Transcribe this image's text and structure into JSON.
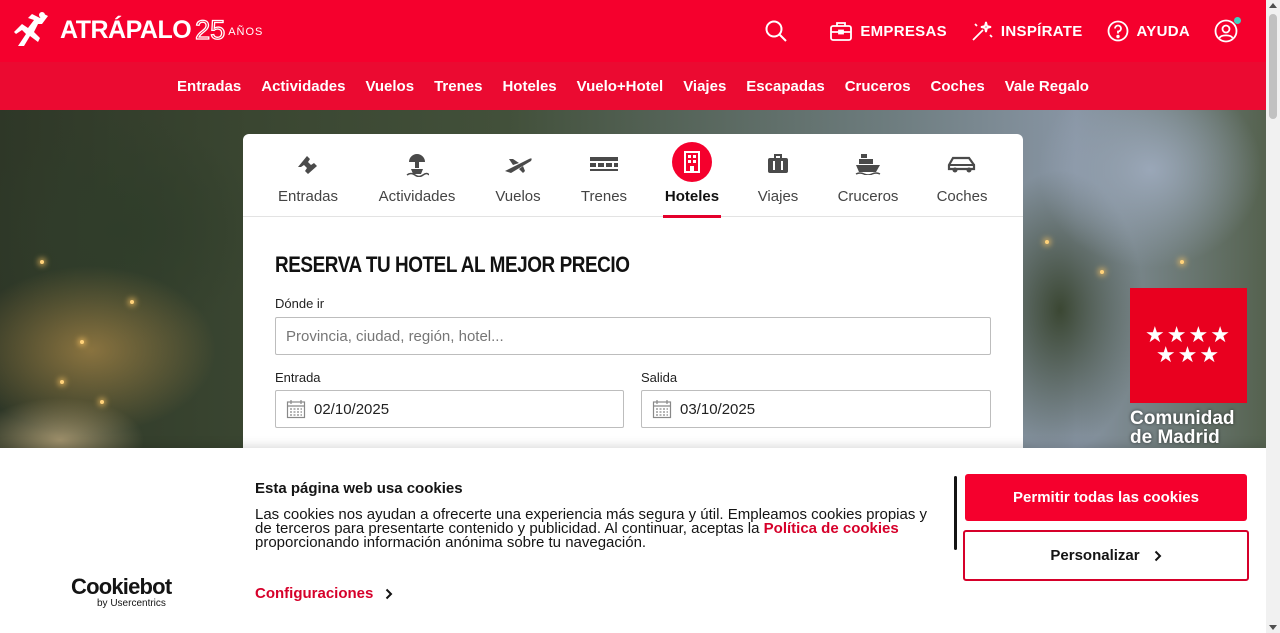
{
  "brand": {
    "name": "ATRÁPALO",
    "anniversary_number": "25",
    "anniversary_word": "AÑOS",
    "primary_color": "#f5002d",
    "nav_color": "#eb0a31"
  },
  "header": {
    "actions": [
      {
        "label": "EMPRESAS",
        "icon": "briefcase-icon"
      },
      {
        "label": "INSPÍRATE",
        "icon": "sparkle-icon"
      },
      {
        "label": "AYUDA",
        "icon": "help-icon"
      }
    ]
  },
  "nav": {
    "items": [
      "Entradas",
      "Actividades",
      "Vuelos",
      "Trenes",
      "Hoteles",
      "Vuelo+Hotel",
      "Viajes",
      "Escapadas",
      "Cruceros",
      "Coches",
      "Vale Regalo"
    ]
  },
  "search_card": {
    "tabs": [
      {
        "label": "Entradas",
        "icon": "ticket-icon",
        "active": false
      },
      {
        "label": "Actividades",
        "icon": "activity-icon",
        "active": false
      },
      {
        "label": "Vuelos",
        "icon": "plane-icon",
        "active": false
      },
      {
        "label": "Trenes",
        "icon": "train-icon",
        "active": false
      },
      {
        "label": "Hoteles",
        "icon": "hotel-icon",
        "active": true
      },
      {
        "label": "Viajes",
        "icon": "luggage-icon",
        "active": false
      },
      {
        "label": "Cruceros",
        "icon": "ship-icon",
        "active": false
      },
      {
        "label": "Coches",
        "icon": "car-icon",
        "active": false
      }
    ],
    "title": "RESERVA TU HOTEL AL MEJOR PRECIO",
    "destination": {
      "label": "Dónde ir",
      "placeholder": "Provincia, ciudad, región, hotel..."
    },
    "checkin": {
      "label": "Entrada",
      "value": "02/10/2025"
    },
    "checkout": {
      "label": "Salida",
      "value": "03/10/2025"
    }
  },
  "sponsor": {
    "name_line1": "Comunidad",
    "name_line2": "de Madrid"
  },
  "cookie_banner": {
    "provider": "Cookiebot",
    "provider_sub": "by Usercentrics",
    "title": "Esta página web usa cookies",
    "text_before_link": "Las cookies nos ayudan a ofrecerte una experiencia más segura y útil. Empleamos cookies propias y de terceros para presentarte contenido y publicidad. Al continuar, aceptas la ",
    "link_text": "Política de cookies",
    "text_after_link": " proporcionando información anónima sobre tu navegación.",
    "settings_label": "Configuraciones",
    "allow_all_label": "Permitir todas las cookies",
    "customize_label": "Personalizar"
  }
}
